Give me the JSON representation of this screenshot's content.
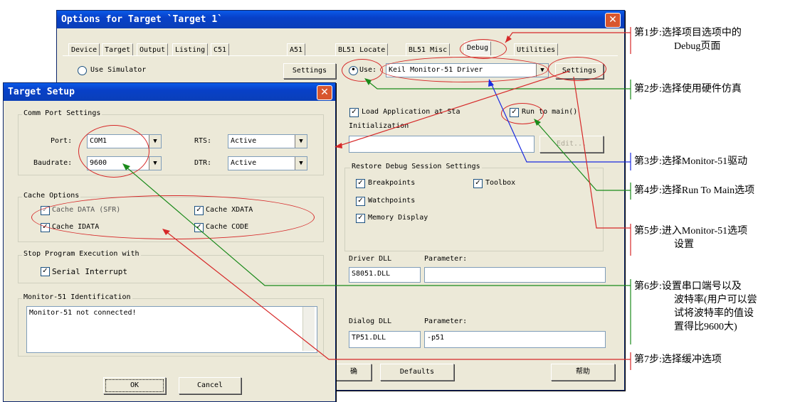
{
  "options_window": {
    "title": "Options for Target `Target 1`",
    "close_glyph": "✕",
    "tabs": [
      "Device",
      "Target",
      "Output",
      "Listing",
      "C51",
      "A51",
      "BL51 Locate",
      "BL51 Misc",
      "Debug",
      "Utilities"
    ],
    "use_simulator_label": "Use Simulator",
    "settings_label_left": "Settings",
    "use_label": "Use:",
    "driver_value": "Keil Monitor-51 Driver",
    "settings_label_right": "Settings",
    "load_app_label": "Load Application at Sta",
    "run_to_main_label": "Run to main()",
    "initialization_label": "Initialization",
    "edit_label": "Edit...",
    "restore_group_label": "Restore Debug Session Settings",
    "restore_items": {
      "breakpoints": "Breakpoints",
      "toolbox": "Toolbox",
      "watchpoints": "Watchpoints",
      "memory_display": "Memory Display"
    },
    "driver_dll_label": "Driver DLL",
    "parameter_label_1": "Parameter:",
    "driver_dll_value": "S8051.DLL",
    "dialog_dll_label": "Dialog DLL",
    "parameter_label_2": "Parameter:",
    "dialog_dll_value": "TP51.DLL",
    "dialog_param_value": "-p51",
    "ok_partial": "确",
    "defaults_label": "Defaults",
    "help_label": "帮助"
  },
  "target_setup": {
    "title": "Target Setup",
    "close_glyph": "✕",
    "comm_group": "Comm Port Settings",
    "port_label": "Port:",
    "port_value": "COM1",
    "rts_label": "RTS:",
    "rts_value": "Active",
    "baud_label": "Baudrate:",
    "baud_value": "9600",
    "dtr_label": "DTR:",
    "dtr_value": "Active",
    "cache_group": "Cache Options",
    "cache_data": "Cache DATA (SFR)",
    "cache_xdata": "Cache XDATA",
    "cache_idata": "Cache IDATA",
    "cache_code": "Cache CODE",
    "stop_group": "Stop Program Execution with",
    "serial_interrupt": "Serial Interrupt",
    "monitor_group": "Monitor-51 Identification",
    "monitor_text": "Monitor-51 not connected!",
    "ok_label": "OK",
    "cancel_label": "Cancel"
  },
  "steps": [
    {
      "label": "第1步:选择项目选项中的",
      "cont": "Debug页面"
    },
    {
      "label": "第2步:选择使用硬件仿真",
      "cont": ""
    },
    {
      "label": "第3步:选择Monitor-51驱动",
      "cont": ""
    },
    {
      "label": "第4步:选择Run To Main选项",
      "cont": ""
    },
    {
      "label": "第5步:进入Monitor-51选项",
      "cont": "设置"
    },
    {
      "label": "第6步:设置串口端号以及",
      "cont": "波特率(用户可以尝"
    },
    {
      "label": "",
      "cont": "试将波特率的值设"
    },
    {
      "label": "",
      "cont": "置得比9600大)"
    },
    {
      "label": "第7步:选择缓冲选项",
      "cont": ""
    }
  ],
  "colors": {
    "red": "#d62828",
    "green": "#1a8a1a",
    "blue": "#1a2ae0",
    "title_blue": "#0a4fd8"
  }
}
